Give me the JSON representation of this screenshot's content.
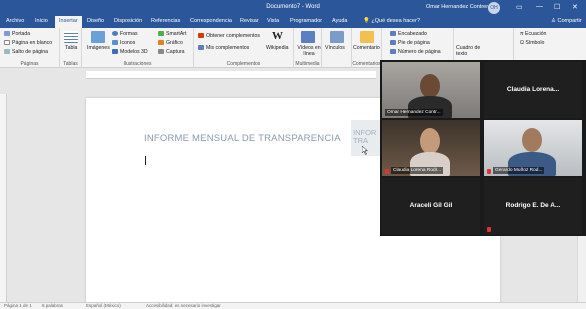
{
  "titlebar": {
    "doc_title": "Documento7 - Word",
    "user": "Omar Hernandez Contreras",
    "avatar_initials": "OH",
    "minimize": "—",
    "maximize": "☐",
    "close": "✕"
  },
  "tabs": [
    {
      "label": "Archivo"
    },
    {
      "label": "Inicio"
    },
    {
      "label": "Insertar",
      "active": true
    },
    {
      "label": "Diseño"
    },
    {
      "label": "Disposición"
    },
    {
      "label": "Referencias"
    },
    {
      "label": "Correspondencia"
    },
    {
      "label": "Revisar"
    },
    {
      "label": "Vista"
    },
    {
      "label": "Programador"
    },
    {
      "label": "Ayuda"
    }
  ],
  "tell_me": "¿Qué desea hacer?",
  "share": "Compartir",
  "ribbon": {
    "paginas": {
      "items": [
        "Portada",
        "Página en blanco",
        "Salto de página"
      ],
      "label": "Páginas"
    },
    "tablas": {
      "item": "Tabla",
      "label": "Tablas"
    },
    "ilustraciones": {
      "imagenes": "Imágenes",
      "formas": "Formas",
      "iconos": "Iconos",
      "modelos3d": "Modelos 3D",
      "smartart": "SmartArt",
      "grafico": "Gráfico",
      "captura": "Captura",
      "label": "Ilustraciones"
    },
    "complementos": {
      "obtener": "Obtener complementos",
      "mis": "Mis complementos",
      "wikipedia": "Wikipedia",
      "label": "Complementos"
    },
    "multimedia": {
      "videos": "Vídeos en línea",
      "label": "Multimedia"
    },
    "vinculos": {
      "item": "Vínculos",
      "label": ""
    },
    "comentarios": {
      "item": "Comentario",
      "label": "Comentarios"
    },
    "encabezado": {
      "items": [
        "Encabezado",
        "Pie de página",
        "Número de página"
      ],
      "label": "Encabezado y pie de página"
    },
    "texto": {
      "item": "Cuadro de texto",
      "label": "Texto"
    },
    "simbolos": {
      "items": [
        "Ecuación",
        "Símbolo"
      ],
      "label": "Símbolos"
    }
  },
  "document": {
    "heading": "INFORME MENSUAL DE TRANSPARENCIA",
    "textbox_lines": [
      "INFOR",
      "TRA"
    ]
  },
  "statusbar": {
    "page": "Página 1 de 1",
    "words": "6 palabras",
    "language": "Español (México)",
    "accessibility": "Accesibilidad: es necesario investigar"
  },
  "meeting": {
    "participants": [
      {
        "name": "Omar Hernandez Contr...",
        "video": true,
        "active": true,
        "muted": false
      },
      {
        "name": "Claudia  Lorena...",
        "video": false,
        "muted": false
      },
      {
        "name": "Claudia Lorena Rodr...",
        "video": true,
        "muted": true
      },
      {
        "name": "Gerardo Muñoz Rod...",
        "video": true,
        "muted": true
      },
      {
        "name": "Araceli Gil Gil",
        "video": false,
        "muted": false
      },
      {
        "name": "Rodrigo E. De A...",
        "video": false,
        "muted": true
      }
    ]
  },
  "colors": {
    "word_blue": "#2b579a",
    "ribbon_bg": "#f3f3f3",
    "active_speaker": "#f2e04a",
    "meeting_bg": "#1a1a1a"
  }
}
